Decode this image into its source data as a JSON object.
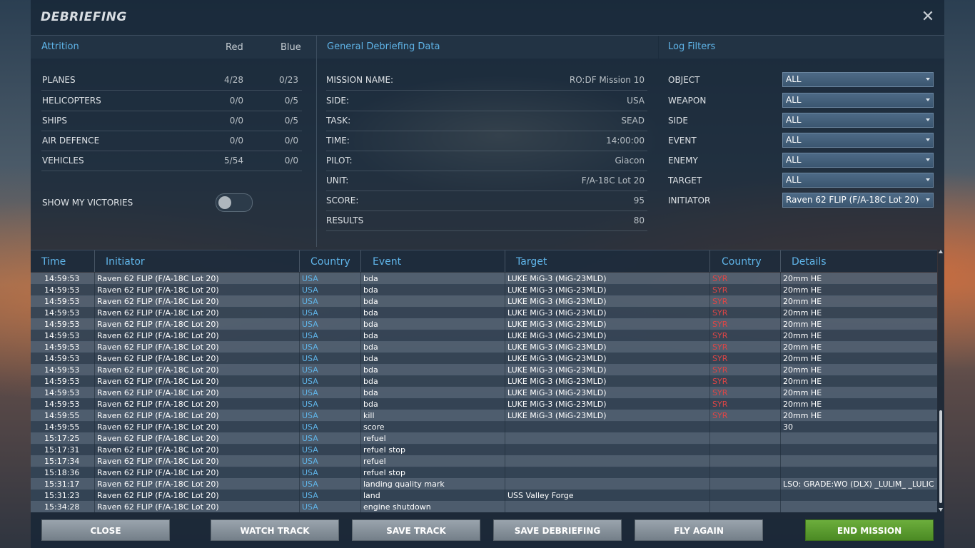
{
  "window": {
    "title": "DEBRIEFING"
  },
  "attrition": {
    "title": "Attrition",
    "col_red": "Red",
    "col_blue": "Blue",
    "rows": [
      {
        "label": "PLANES",
        "red": "4/28",
        "blue": "0/23"
      },
      {
        "label": "HELICOPTERS",
        "red": "0/0",
        "blue": "0/5"
      },
      {
        "label": "SHIPS",
        "red": "0/0",
        "blue": "0/5"
      },
      {
        "label": "AIR DEFENCE",
        "red": "0/0",
        "blue": "0/0"
      },
      {
        "label": "VEHICLES",
        "red": "5/54",
        "blue": "0/0"
      }
    ],
    "show_victories_label": "SHOW MY VICTORIES",
    "show_victories_on": false
  },
  "general": {
    "title": "General Debriefing Data",
    "rows": [
      {
        "label": "MISSION NAME:",
        "value": "RO:DF Mission 10"
      },
      {
        "label": "SIDE:",
        "value": "USA"
      },
      {
        "label": "TASK:",
        "value": "SEAD"
      },
      {
        "label": "TIME:",
        "value": "14:00:00"
      },
      {
        "label": "PILOT:",
        "value": "Giacon"
      },
      {
        "label": "UNIT:",
        "value": "F/A-18C Lot 20"
      },
      {
        "label": "SCORE:",
        "value": "95"
      },
      {
        "label": "RESULTS",
        "value": "80"
      }
    ]
  },
  "filters": {
    "title": "Log Filters",
    "rows": [
      {
        "label": "OBJECT",
        "value": "ALL"
      },
      {
        "label": "WEAPON",
        "value": "ALL"
      },
      {
        "label": "SIDE",
        "value": "ALL"
      },
      {
        "label": "EVENT",
        "value": "ALL"
      },
      {
        "label": "ENEMY",
        "value": "ALL"
      },
      {
        "label": "TARGET",
        "value": "ALL"
      },
      {
        "label": "INITIATOR",
        "value": "Raven 62 FLIP (F/A-18C Lot 20)"
      }
    ]
  },
  "log": {
    "headers": {
      "time": "Time",
      "initiator": "Initiator",
      "country": "Country",
      "event": "Event",
      "target": "Target",
      "target_country": "Country",
      "details": "Details"
    },
    "rows": [
      {
        "time": "14:59:53",
        "initiator": "Raven 62 FLIP (F/A-18C Lot 20)",
        "country": "USA",
        "event": "bda",
        "target": "LUKE MiG-3 (MiG-23MLD)",
        "target_country": "SYR",
        "details": "20mm HE"
      },
      {
        "time": "14:59:53",
        "initiator": "Raven 62 FLIP (F/A-18C Lot 20)",
        "country": "USA",
        "event": "bda",
        "target": "LUKE MiG-3 (MiG-23MLD)",
        "target_country": "SYR",
        "details": "20mm HE"
      },
      {
        "time": "14:59:53",
        "initiator": "Raven 62 FLIP (F/A-18C Lot 20)",
        "country": "USA",
        "event": "bda",
        "target": "LUKE MiG-3 (MiG-23MLD)",
        "target_country": "SYR",
        "details": "20mm HE"
      },
      {
        "time": "14:59:53",
        "initiator": "Raven 62 FLIP (F/A-18C Lot 20)",
        "country": "USA",
        "event": "bda",
        "target": "LUKE MiG-3 (MiG-23MLD)",
        "target_country": "SYR",
        "details": "20mm HE"
      },
      {
        "time": "14:59:53",
        "initiator": "Raven 62 FLIP (F/A-18C Lot 20)",
        "country": "USA",
        "event": "bda",
        "target": "LUKE MiG-3 (MiG-23MLD)",
        "target_country": "SYR",
        "details": "20mm HE"
      },
      {
        "time": "14:59:53",
        "initiator": "Raven 62 FLIP (F/A-18C Lot 20)",
        "country": "USA",
        "event": "bda",
        "target": "LUKE MiG-3 (MiG-23MLD)",
        "target_country": "SYR",
        "details": "20mm HE"
      },
      {
        "time": "14:59:53",
        "initiator": "Raven 62 FLIP (F/A-18C Lot 20)",
        "country": "USA",
        "event": "bda",
        "target": "LUKE MiG-3 (MiG-23MLD)",
        "target_country": "SYR",
        "details": "20mm HE"
      },
      {
        "time": "14:59:53",
        "initiator": "Raven 62 FLIP (F/A-18C Lot 20)",
        "country": "USA",
        "event": "bda",
        "target": "LUKE MiG-3 (MiG-23MLD)",
        "target_country": "SYR",
        "details": "20mm HE"
      },
      {
        "time": "14:59:53",
        "initiator": "Raven 62 FLIP (F/A-18C Lot 20)",
        "country": "USA",
        "event": "bda",
        "target": "LUKE MiG-3 (MiG-23MLD)",
        "target_country": "SYR",
        "details": "20mm HE"
      },
      {
        "time": "14:59:53",
        "initiator": "Raven 62 FLIP (F/A-18C Lot 20)",
        "country": "USA",
        "event": "bda",
        "target": "LUKE MiG-3 (MiG-23MLD)",
        "target_country": "SYR",
        "details": "20mm HE"
      },
      {
        "time": "14:59:53",
        "initiator": "Raven 62 FLIP (F/A-18C Lot 20)",
        "country": "USA",
        "event": "bda",
        "target": "LUKE MiG-3 (MiG-23MLD)",
        "target_country": "SYR",
        "details": "20mm HE"
      },
      {
        "time": "14:59:53",
        "initiator": "Raven 62 FLIP (F/A-18C Lot 20)",
        "country": "USA",
        "event": "bda",
        "target": "LUKE MiG-3 (MiG-23MLD)",
        "target_country": "SYR",
        "details": "20mm HE"
      },
      {
        "time": "14:59:55",
        "initiator": "Raven 62 FLIP (F/A-18C Lot 20)",
        "country": "USA",
        "event": "kill",
        "target": "LUKE MiG-3 (MiG-23MLD)",
        "target_country": "SYR",
        "details": "20mm HE"
      },
      {
        "time": "14:59:55",
        "initiator": "Raven 62 FLIP (F/A-18C Lot 20)",
        "country": "USA",
        "event": "score",
        "target": "",
        "target_country": "",
        "details": "30"
      },
      {
        "time": "15:17:25",
        "initiator": "Raven 62 FLIP (F/A-18C Lot 20)",
        "country": "USA",
        "event": "refuel",
        "target": "",
        "target_country": "",
        "details": ""
      },
      {
        "time": "15:17:31",
        "initiator": "Raven 62 FLIP (F/A-18C Lot 20)",
        "country": "USA",
        "event": "refuel stop",
        "target": "",
        "target_country": "",
        "details": ""
      },
      {
        "time": "15:17:34",
        "initiator": "Raven 62 FLIP (F/A-18C Lot 20)",
        "country": "USA",
        "event": "refuel",
        "target": "",
        "target_country": "",
        "details": ""
      },
      {
        "time": "15:18:36",
        "initiator": "Raven 62 FLIP (F/A-18C Lot 20)",
        "country": "USA",
        "event": "refuel stop",
        "target": "",
        "target_country": "",
        "details": ""
      },
      {
        "time": "15:31:17",
        "initiator": "Raven 62 FLIP (F/A-18C Lot 20)",
        "country": "USA",
        "event": "landing quality mark",
        "target": "",
        "target_country": "",
        "details": "LSO: GRADE:WO  (DLX)  _LULIM_  _LULIC"
      },
      {
        "time": "15:31:23",
        "initiator": "Raven 62 FLIP (F/A-18C Lot 20)",
        "country": "USA",
        "event": "land",
        "target": "USS Valley Forge",
        "target_country": "",
        "details": ""
      },
      {
        "time": "15:34:28",
        "initiator": "Raven 62 FLIP (F/A-18C Lot 20)",
        "country": "USA",
        "event": "engine shutdown",
        "target": "",
        "target_country": "",
        "details": ""
      }
    ]
  },
  "buttons": {
    "close": "CLOSE",
    "watch_track": "WATCH TRACK",
    "save_track": "SAVE TRACK",
    "save_debriefing": "SAVE DEBRIEFING",
    "fly_again": "FLY AGAIN",
    "end_mission": "END MISSION"
  },
  "colors": {
    "accent": "#5fb4e8",
    "friendly_country": "#5fb4e8",
    "enemy_country": "#e04545",
    "end_mission_button": "#5e9e30"
  }
}
